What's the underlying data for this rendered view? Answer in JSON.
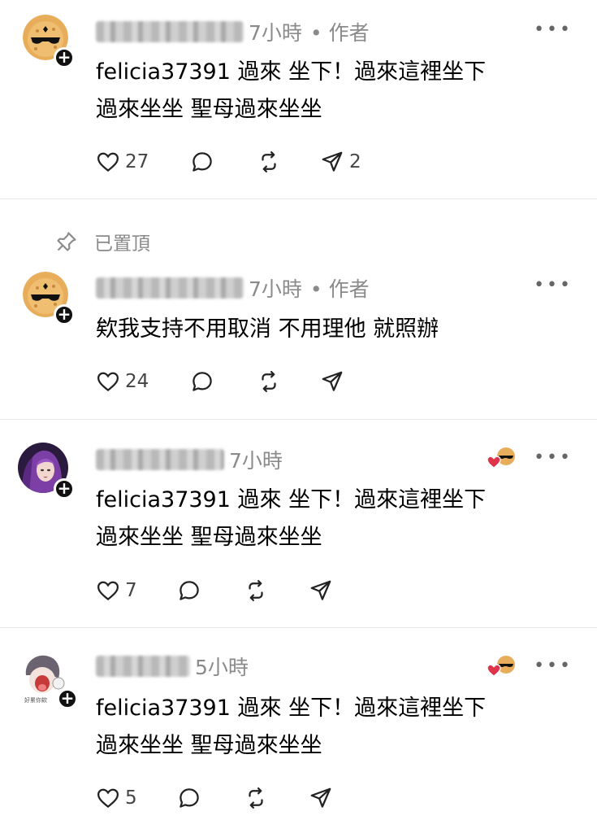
{
  "posts": [
    {
      "time": "7小時",
      "author_tag": "• 作者",
      "text_line1": "felicia37391 過來 坐下！過來這裡坐下",
      "text_line2": "過來坐坐 聖母過來坐坐",
      "likes": "27",
      "shares": "2",
      "avatar": "sunglasses-cookie-avatar"
    },
    {
      "pinned_label": "已置頂",
      "time": "7小時",
      "author_tag": "• 作者",
      "text_line1": "欸我支持不用取消 不用理他 就照辦",
      "text_line2": "",
      "likes": "24",
      "avatar": "sunglasses-cookie-avatar"
    },
    {
      "time": "7小時",
      "text_line1": "felicia37391 過來 坐下！過來這裡坐下",
      "text_line2": "過來坐坐 聖母過來坐坐",
      "likes": "7",
      "avatar": "purple-hair-character-avatar"
    },
    {
      "time": "5小時",
      "text_line1": "felicia37391 過來 坐下！過來這裡坐下",
      "text_line2": "過來坐坐 聖母過來坐坐",
      "likes": "5",
      "avatar": "cartoon-shouting-avatar",
      "avatar_caption": "好累你欸"
    }
  ],
  "colors": {
    "meta_gray": "#8a8a8a",
    "divider": "#e6e6e6",
    "heart_red": "#e0344b"
  },
  "icons": [
    "heart-icon",
    "comment-icon",
    "repost-icon",
    "share-icon",
    "pin-icon",
    "more-icon"
  ]
}
